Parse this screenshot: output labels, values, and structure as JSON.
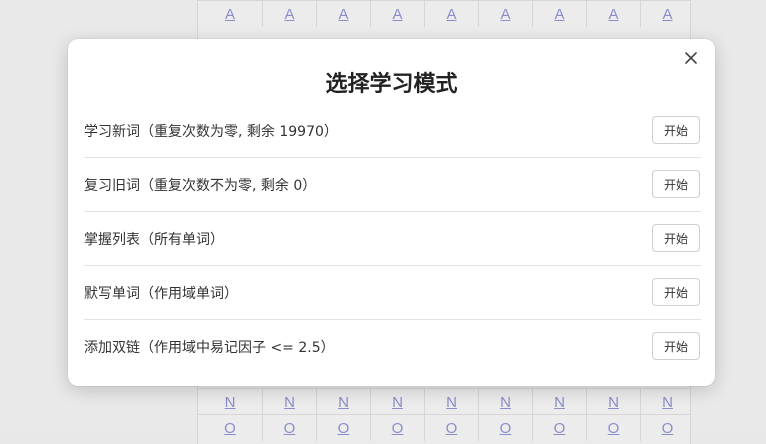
{
  "background": {
    "top_row": [
      "A",
      "A",
      "A",
      "A",
      "A",
      "A",
      "A",
      "A",
      "A"
    ],
    "bottom_row": [
      "N",
      "N",
      "N",
      "N",
      "N",
      "N",
      "N",
      "N",
      "N"
    ],
    "bottom_row_partial": [
      "O",
      "O",
      "O",
      "O",
      "O",
      "O",
      "O",
      "O",
      "O"
    ]
  },
  "dialog": {
    "title": "选择学习模式",
    "close_icon": "close-icon",
    "modes": [
      {
        "label": "学习新词（重复次数为零, 剩余 19970）",
        "button": "开始"
      },
      {
        "label": "复习旧词（重复次数不为零, 剩余 0）",
        "button": "开始"
      },
      {
        "label": "掌握列表（所有单词）",
        "button": "开始"
      },
      {
        "label": "默写单词（作用域单词）",
        "button": "开始"
      },
      {
        "label": "添加双链（作用域中易记因子 <= 2.5）",
        "button": "开始"
      }
    ]
  },
  "colors": {
    "link": "#8a8ec8",
    "dialog_bg": "#ffffff",
    "page_bg": "#e9e9e9"
  }
}
